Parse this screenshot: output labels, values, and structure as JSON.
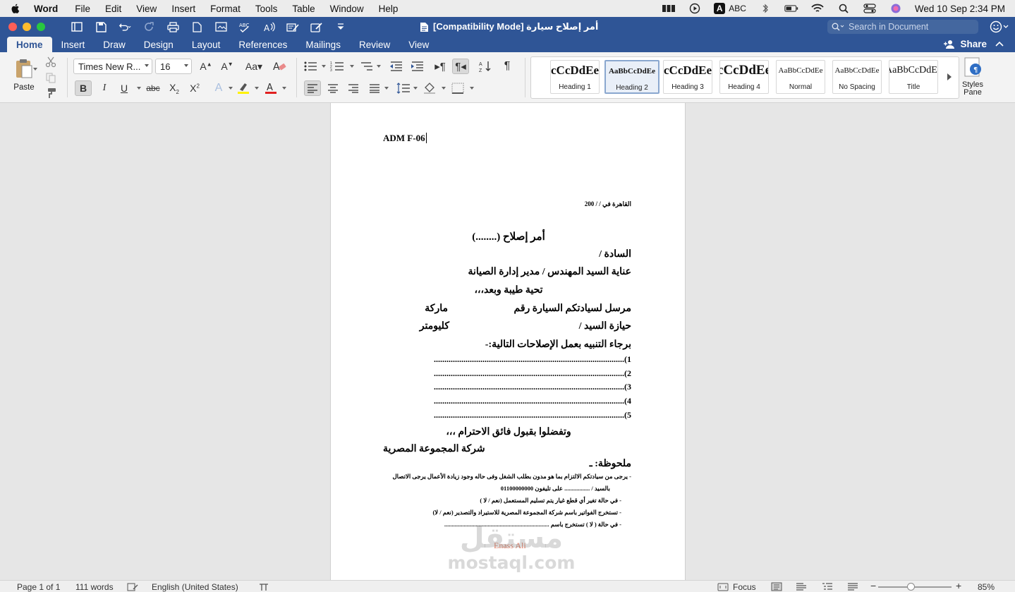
{
  "menubar": {
    "app": "Word",
    "items": [
      "File",
      "Edit",
      "View",
      "Insert",
      "Format",
      "Tools",
      "Table",
      "Window",
      "Help"
    ],
    "input_source": "ABC",
    "clock": "Wed 10 Sep  2:34 PM"
  },
  "window": {
    "title": "أمر إصلاح سيارة  [Compatibility Mode]",
    "search_placeholder": "Search in Document"
  },
  "tabs": [
    "Home",
    "Insert",
    "Draw",
    "Design",
    "Layout",
    "References",
    "Mailings",
    "Review",
    "View"
  ],
  "active_tab": "Home",
  "share_label": "Share",
  "ribbon": {
    "paste_label": "Paste",
    "font_name": "Times New R...",
    "font_size": "16",
    "styles": [
      {
        "preview": "cCcDdEe",
        "name": "Heading 1"
      },
      {
        "preview": "AaBbCcDdEe",
        "name": "Heading 2"
      },
      {
        "preview": "cCcDdEe",
        "name": "Heading 3"
      },
      {
        "preview": "cCcDdEe",
        "name": "Heading 4"
      },
      {
        "preview": "AaBbCcDdEe",
        "name": "Normal"
      },
      {
        "preview": "AaBbCcDdEe",
        "name": "No Spacing"
      },
      {
        "preview": "AaBbCcDdEe",
        "name": "Title"
      }
    ],
    "selected_style": "Heading 2",
    "styles_pane_label": "Styles Pane"
  },
  "document": {
    "code": "ADM F-06",
    "date_line": "القاهرة في    /    /    200",
    "heading": "أمر إصلاح (........)",
    "to": "السادة /",
    "attention": "عناية السيد المهندس / مدير إدارة الصيانة",
    "greeting": "تحية طيبة وبعد،،،",
    "car_line_a": "مرسل لسيادتكم السيارة رقم",
    "car_line_b": "ماركة",
    "holder_a": "حيازة السيد /",
    "holder_b": "كليومتر",
    "request": "برجاء التنبيه بعمل الإصلاحات التالية:-",
    "items": [
      "1)..........................................................................................",
      "2)..........................................................................................",
      "3)..........................................................................................",
      "4)..........................................................................................",
      "5).........................................................................................."
    ],
    "closing": "وتفضلوا بقبول فائق الاحترام ،،،",
    "company": "شركة المجموعة المصرية",
    "note_title": "ملحوظة: ـ",
    "notes": [
      "-    يرجى من سيادتكم الالتزام بما هو مدون بطلب الشغل وفى حاله وجود زيادة الأعمال يرجى الاتصال",
      "بالسيد /   .................  على تليفون 01100000000",
      "-    في حالة تغير أي قطع غيار يتم تسليم المستعمل (نعم    /    لا   )",
      "-    تستخرج الفواتير باسم شركة المجموعة المصرية للاستيراد والتصدير (نعم   /   لا)",
      "-    في حالة ( لا )  تستخرج باسم ......................................................................"
    ],
    "signature": "Enass Ali"
  },
  "statusbar": {
    "page": "Page 1 of 1",
    "words": "111 words",
    "language": "English (United States)",
    "focus": "Focus",
    "zoom": "85%"
  },
  "watermark": {
    "arabic": "مستقل",
    "latin": "mostaql.com"
  },
  "colors": {
    "title_bar": "#2f5596",
    "accent": "#2f5596",
    "signature": "#e07b62"
  }
}
